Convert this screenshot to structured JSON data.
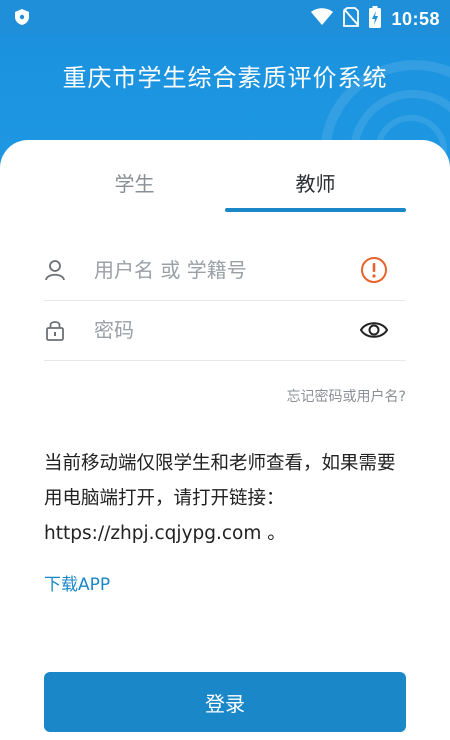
{
  "status_bar": {
    "time": "10:58",
    "icons": [
      "shield-icon",
      "wifi-icon",
      "no-sim-icon",
      "battery-charging-icon"
    ]
  },
  "header": {
    "title": "重庆市学生综合素质评价系统"
  },
  "tabs": [
    {
      "label": "学生",
      "active": false
    },
    {
      "label": "教师",
      "active": true
    }
  ],
  "form": {
    "username": {
      "placeholder": "用户名 或 学籍号",
      "value": "",
      "icon": "user-icon",
      "action_icon": "alert-circle-icon"
    },
    "password": {
      "placeholder": "密码",
      "value": "",
      "icon": "lock-icon",
      "action_icon": "eye-icon"
    },
    "forgot_link": "忘记密码或用户名?"
  },
  "notice": {
    "text": "当前移动端仅限学生和老师查看，如果需要用电脑端打开，请打开链接：https://zhpj.cqjypg.com 。"
  },
  "download_link": "下载APP",
  "login_button": "登录",
  "colors": {
    "primary": "#1a87c8",
    "header": "#1f9be5",
    "warning": "#e8632b"
  }
}
